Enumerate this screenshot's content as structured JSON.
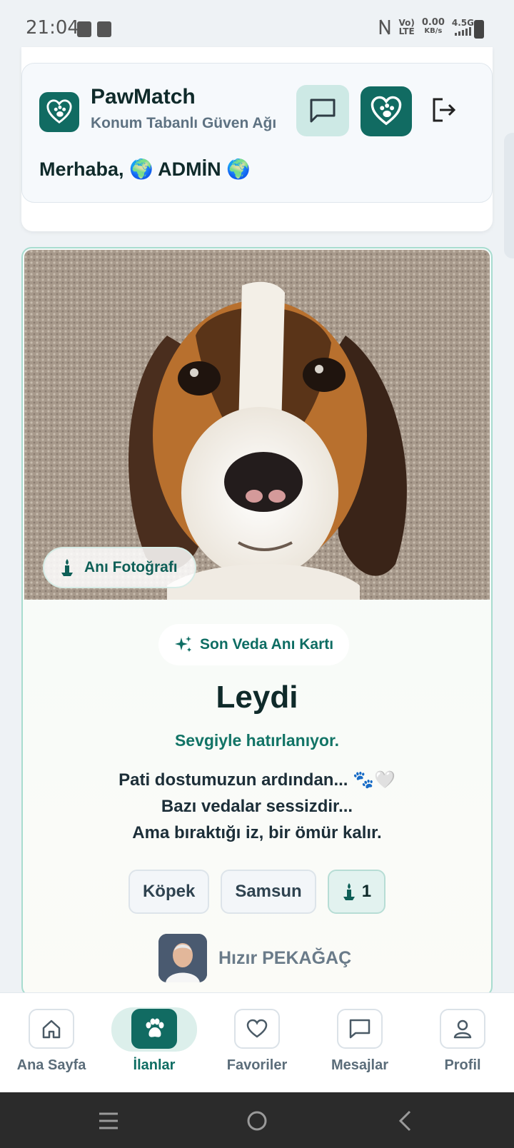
{
  "status_bar": {
    "time": "21:04",
    "network_top": "Vo)",
    "network_bottom": "LTE",
    "speed_value": "0.00",
    "speed_unit": "KB/s",
    "network_type": "4.5G"
  },
  "header": {
    "app_name": "PawMatch",
    "subtitle": "Konum Tabanlı Güven Ağı",
    "greeting": "Merhaba, 🌍 ADMİN 🌍"
  },
  "memorial": {
    "photo_badge": "Anı Fotoğrafı",
    "card_type": "Son Veda Anı Kartı",
    "pet_name": "Leydi",
    "tagline": "Sevgiyle hatırlanıyor.",
    "message_lines": [
      "Pati dostumuzun ardından... 🐾🤍",
      "Bazı vedalar sessizdir...",
      "Ama bıraktığı iz, bir ömür kalır."
    ],
    "chips": {
      "species": "Köpek",
      "city": "Samsun",
      "candle_count": "1"
    },
    "owner_name": "Hızır PEKAĞAÇ"
  },
  "bottom_nav": {
    "items": [
      {
        "label": "Ana Sayfa",
        "icon": "home-icon"
      },
      {
        "label": "İlanlar",
        "icon": "paw-icon"
      },
      {
        "label": "Favoriler",
        "icon": "heart-icon"
      },
      {
        "label": "Mesajlar",
        "icon": "chat-icon"
      },
      {
        "label": "Profil",
        "icon": "user-icon"
      }
    ],
    "active_index": 1
  },
  "colors": {
    "brand": "#116b62",
    "brand_light": "#cde9e5",
    "card_border": "#a8dccf"
  }
}
